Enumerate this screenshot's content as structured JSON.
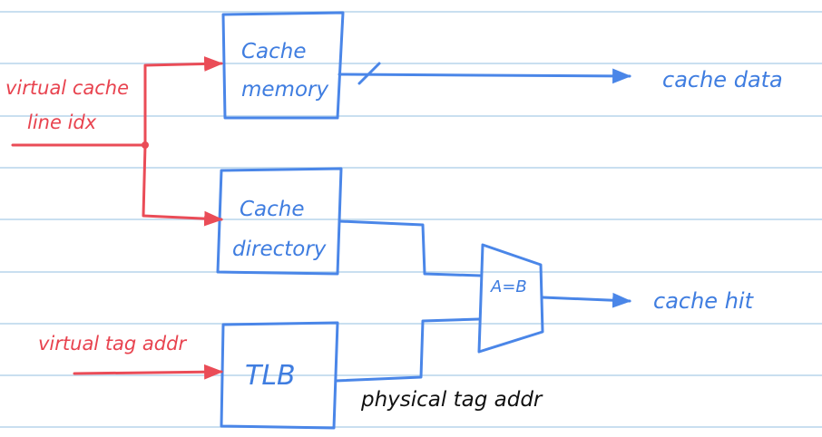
{
  "colors": {
    "rule_line": "#c9dff0",
    "hardware": "#4a86e8",
    "input": "#ea4c57",
    "annotation": "#111111"
  },
  "blocks": {
    "cache_memory": [
      "Cache",
      "memory"
    ],
    "cache_directory": [
      "Cache",
      "directory"
    ],
    "tlb": "TLB",
    "comparator": "A=B"
  },
  "inputs": {
    "virtual_cache_line_idx": [
      "virtual cache",
      "line idx"
    ],
    "virtual_tag_addr": "virtual tag addr"
  },
  "outputs": {
    "cache_data": "cache data",
    "cache_hit": "cache hit"
  },
  "annotations": {
    "physical_tag_addr": "physical tag addr"
  }
}
